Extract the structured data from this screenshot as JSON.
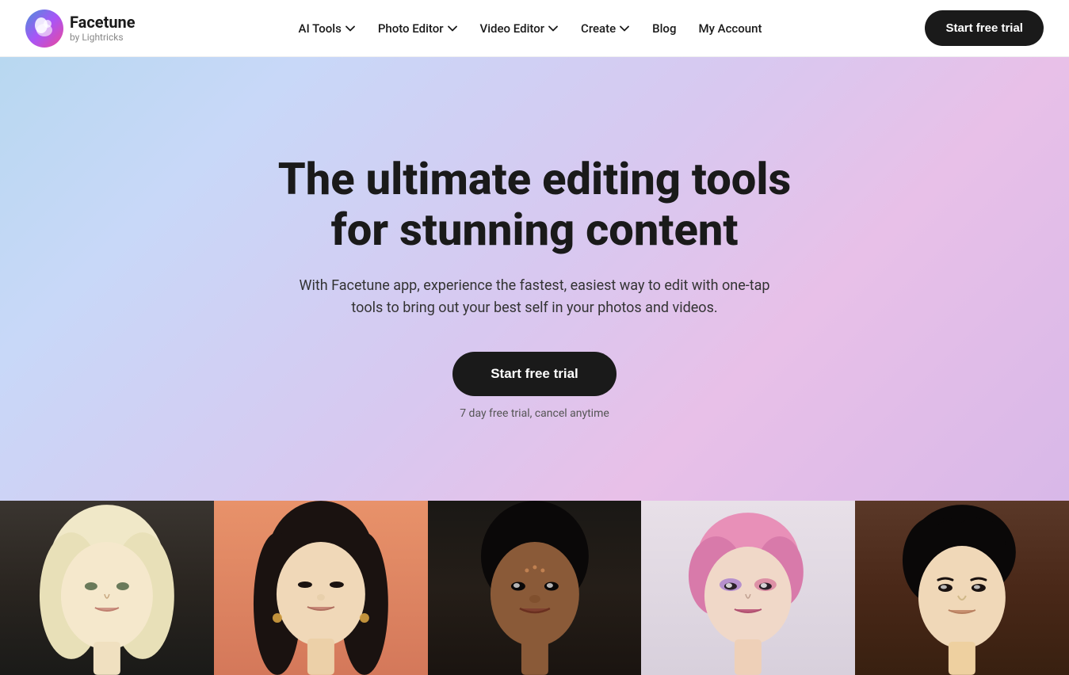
{
  "brand": {
    "name": "Facetune",
    "sub": "by Lightricks"
  },
  "nav": {
    "items": [
      {
        "label": "AI Tools",
        "has_dropdown": true
      },
      {
        "label": "Photo Editor",
        "has_dropdown": true
      },
      {
        "label": "Video Editor",
        "has_dropdown": true
      },
      {
        "label": "Create",
        "has_dropdown": true
      },
      {
        "label": "Blog",
        "has_dropdown": false
      },
      {
        "label": "My Account",
        "has_dropdown": false
      }
    ],
    "cta_label": "Start free trial"
  },
  "hero": {
    "title_line1": "The ultimate editing tools",
    "title_line2": "for stunning content",
    "subtitle": "With Facetune app, experience the fastest, easiest way to edit with one-tap tools to bring out your best self in your photos and videos.",
    "cta_label": "Start free trial",
    "note": "7 day free trial, cancel anytime"
  },
  "photos": [
    {
      "id": 1,
      "alt": "blonde woman portrait",
      "bg": "#2a2520"
    },
    {
      "id": 2,
      "alt": "asian woman on coral background",
      "bg": "#d4785a"
    },
    {
      "id": 3,
      "alt": "dark-skinned woman portrait",
      "bg": "#1a1815"
    },
    {
      "id": 4,
      "alt": "person with pink hair",
      "bg": "#d8d0d8"
    },
    {
      "id": 5,
      "alt": "asian man portrait",
      "bg": "#4a2818"
    }
  ],
  "colors": {
    "brand_dark": "#1a1a1a",
    "hero_gradient_start": "#b8d8f0",
    "hero_gradient_end": "#d8b8e8"
  }
}
